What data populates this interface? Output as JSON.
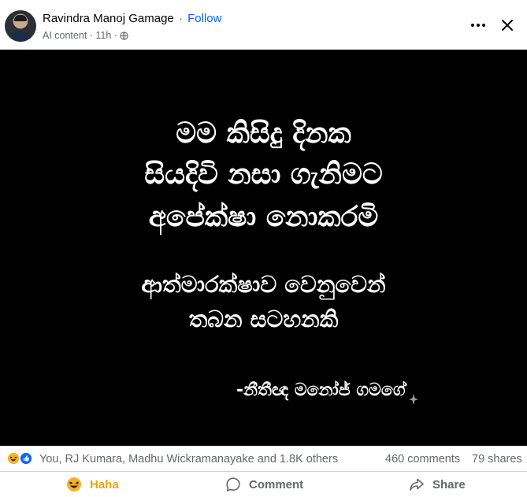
{
  "post": {
    "author": "Ravindra Manoj Gamage",
    "separator": "·",
    "follow_label": "Follow",
    "meta": "AI content · 11h ·"
  },
  "image": {
    "lines": [
      "මම කිසිදු දිනක",
      "සියදිවි නසා ගැනිමට",
      "අපේක්ෂා නොකරමි",
      "ආත්මාරක්ෂාව වෙනුවෙන්",
      "තබන සටහනකි"
    ],
    "signature": "-නීතීඥ මනෝජ් ගමගේ"
  },
  "stats": {
    "reactors": "You, RJ Kumara, Madhu Wickramanayake and 1.8K others",
    "comments": "460 comments",
    "shares": "79 shares"
  },
  "actions": {
    "haha_label": "Haha",
    "comment_label": "Comment",
    "share_label": "Share"
  },
  "icons": {
    "more": "more-options-icon",
    "close": "close-icon",
    "privacy": "globe-icon",
    "haha": "haha-reaction-icon",
    "like": "like-reaction-icon",
    "comment": "comment-icon",
    "share": "share-icon"
  },
  "colors": {
    "follow": "#0866ff",
    "haha": "#f7b125",
    "like": "#0866ff",
    "muted": "#65676b"
  }
}
